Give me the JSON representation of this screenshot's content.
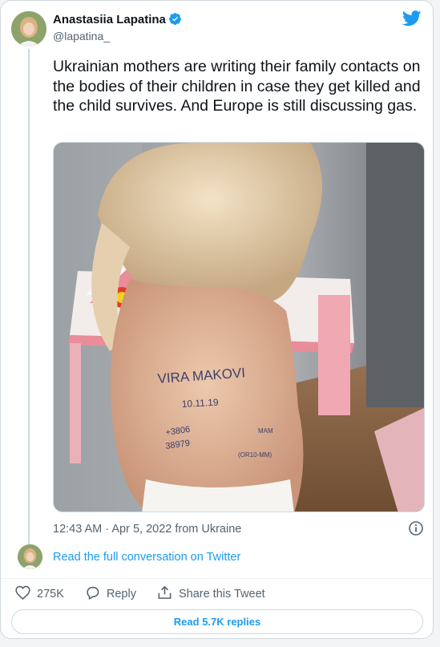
{
  "author": {
    "name": "Anastasiia Lapatina",
    "handle": "@lapatina_"
  },
  "tweet": {
    "text": "Ukrainian mothers are writing their family contacts on the bodies of their children in case they get killed and the child survives. And Europe is still discussing gas.",
    "timestamp": "12:43 AM · Apr 5, 2022 from Ukraine"
  },
  "photo": {
    "writing_line1": "VIRA MAKOVI",
    "writing_line2": "10.11.19",
    "writing_line3": "+3806",
    "writing_line4": "38979",
    "writing_line5": "MAM",
    "writing_line6": "(OR10-MM)"
  },
  "conversation": {
    "link_label": "Read the full conversation on Twitter"
  },
  "actions": {
    "like_count": "275K",
    "reply_label": "Reply",
    "share_label": "Share this Tweet"
  },
  "footer": {
    "replies_button": "Read 5.7K replies"
  },
  "colors": {
    "accent": "#1d9bf0",
    "secondary_text": "#536471",
    "border": "#cfd9de"
  },
  "icons": [
    "verified-badge-icon",
    "twitter-bird-icon",
    "info-icon",
    "heart-icon",
    "reply-icon",
    "share-icon"
  ]
}
